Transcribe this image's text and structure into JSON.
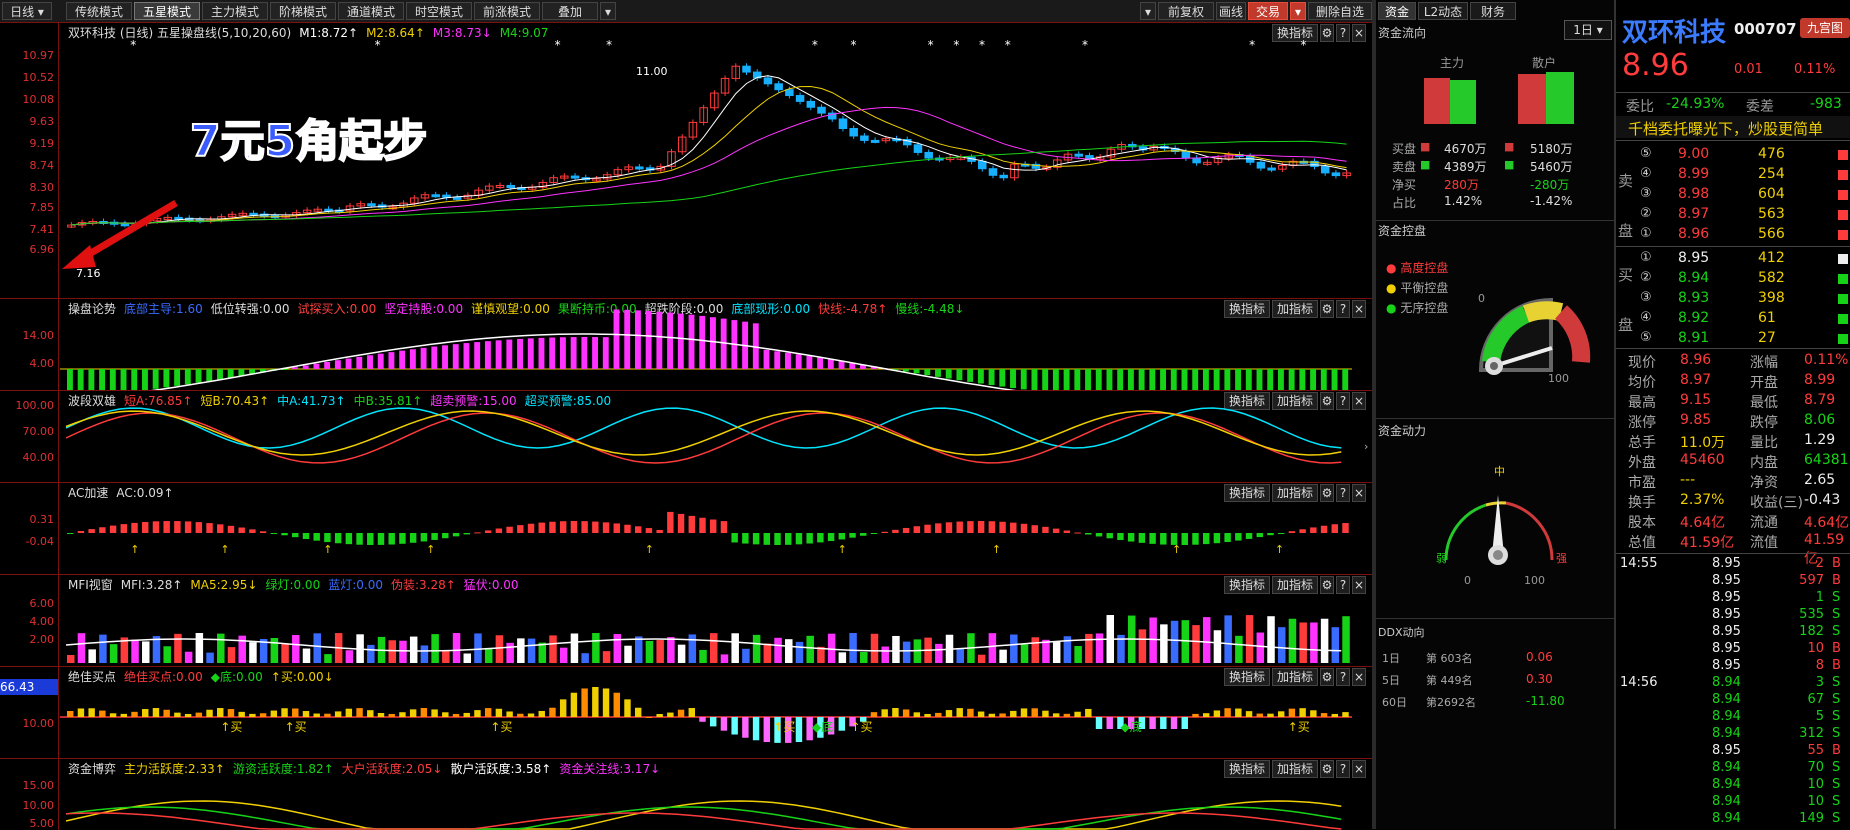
{
  "toolbar": {
    "period": "日线",
    "modes": [
      "传统模式",
      "五星模式",
      "主力模式",
      "阶梯模式",
      "通道模式",
      "时空模式",
      "前涨模式",
      "叠加"
    ],
    "adjust": "前复权",
    "draw": "画线",
    "trade": "交易",
    "del": "删除自选"
  },
  "panel_buttons": {
    "switch": "换指标",
    "add": "加指标",
    "gear": "⚙",
    "help": "?",
    "close": "×"
  },
  "main": {
    "title": [
      "双环科技 (日线) 五星操盘线(5,10,20,60)",
      "M1:8.72↑",
      "M2:8.64↑",
      "M3:8.73↓",
      "M4:9.07"
    ],
    "title_colors": [
      "#dddddd",
      "#ffffff",
      "#f0d000",
      "#ff33ff",
      "#17d317"
    ],
    "ylabels": [
      "10.97",
      "10.52",
      "10.08",
      "9.63",
      "9.19",
      "8.74",
      "8.30",
      "7.85",
      "7.41",
      "6.96"
    ],
    "annotation": "7元5角起步",
    "high_label": "11.00",
    "low_label": "7.16"
  },
  "p1": {
    "title": [
      "操盘论势",
      "底部主导:1.60",
      "低位转强:0.00",
      "试探买入:0.00",
      "坚定持股:0.00",
      "谨慎观望:0.00",
      "果断持币:0.00",
      "超跌阶段:0.00",
      "底部现形:0.00",
      "快线:-4.78↑",
      "慢线:-4.48↓"
    ],
    "title_colors": [
      "#dddddd",
      "#3a6bff",
      "#dddddd",
      "#ff4040",
      "#ff33ff",
      "#f0d000",
      "#17d317",
      "#dddddd",
      "#00e5ff",
      "#ff3b3b",
      "#17d317"
    ],
    "ylabels": [
      "14.00",
      "4.00"
    ]
  },
  "p2": {
    "title": [
      "波段双雄",
      "短A:76.85↑",
      "短B:70.43↑",
      "中A:41.73↑",
      "中B:35.81↑",
      "超卖预警:15.00",
      "超买预警:85.00"
    ],
    "title_colors": [
      "#dddddd",
      "#ff3b3b",
      "#f0d000",
      "#00e5ff",
      "#17d317",
      "#ff33ff",
      "#00e5ff"
    ],
    "ylabels": [
      "100.00",
      "70.00",
      "40.00"
    ]
  },
  "p3": {
    "title": [
      "AC加速",
      "AC:0.09↑"
    ],
    "title_colors": [
      "#dddddd",
      "#dddddd"
    ],
    "ylabels": [
      "0.31",
      "-0.04"
    ]
  },
  "p4": {
    "title": [
      "MFI视窗",
      "MFI:3.28↑",
      "MA5:2.95↓",
      "绿灯:0.00",
      "蓝灯:0.00",
      "伪装:3.28↑",
      "猛伏:0.00"
    ],
    "title_colors": [
      "#dddddd",
      "#dddddd",
      "#f0d000",
      "#17d317",
      "#3a6bff",
      "#ff3b3b",
      "#ff33ff"
    ],
    "ylabels": [
      "6.00",
      "4.00",
      "2.00"
    ]
  },
  "p5": {
    "title": [
      "绝佳买点",
      "绝佳买点:0.00",
      "◆底:0.00",
      "↑买:0.00↓"
    ],
    "title_colors": [
      "#dddddd",
      "#ff3b3b",
      "#17d317",
      "#f0d000"
    ],
    "ylabels": [
      "10.00"
    ],
    "cursor_value": "66.43",
    "buy": "买",
    "bottom": "底"
  },
  "p6": {
    "title": [
      "资金博弈",
      "主力活跃度:2.33↑",
      "游资活跃度:1.82↑",
      "大户活跃度:2.05↓",
      "散户活跃度:3.58↑",
      "资金关注线:3.17↓"
    ],
    "title_colors": [
      "#dddddd",
      "#f0d000",
      "#17d317",
      "#ff3b3b",
      "#ffffff",
      "#ff33ff"
    ],
    "ylabels": [
      "15.00",
      "10.00",
      "5.00"
    ]
  },
  "fund": {
    "tabs": [
      "资金",
      "L2动态",
      "财务"
    ],
    "period": "1日",
    "flow_title": "资金流向",
    "main_label": "主力",
    "retail_label": "散户",
    "rows": [
      {
        "label": "买盘",
        "main": "4670万",
        "retail": "5180万"
      },
      {
        "label": "卖盘",
        "main": "4389万",
        "retail": "5460万"
      },
      {
        "label": "净买",
        "main": "280万",
        "retail": "-280万"
      },
      {
        "label": "占比",
        "main": "1.42%",
        "retail": "-1.42%"
      }
    ],
    "control_title": "资金控盘",
    "control_items": [
      "高度控盘",
      "平衡控盘",
      "无序控盘"
    ],
    "gauge1_min": "0",
    "gauge1_max": "100",
    "power_title": "资金动力",
    "gauge2_labels": {
      "mid": "中",
      "weak": "弱",
      "strong": "强",
      "min": "0",
      "max": "100"
    },
    "ddx_title": "DDX动向",
    "ddx": [
      {
        "period": "1日",
        "rank": "第 603名",
        "value": "0.06"
      },
      {
        "period": "5日",
        "rank": "第 449名",
        "value": "0.30"
      },
      {
        "period": "60日",
        "rank": "第2692名",
        "value": "-11.80"
      }
    ]
  },
  "quote": {
    "name": "双环科技",
    "code": "000707",
    "tag": "九宫图",
    "price": "8.96",
    "change": "0.01",
    "pct": "0.11%",
    "weibi_label": "委比",
    "weibi": "-24.93%",
    "weicha_label": "委差",
    "weicha": "-983",
    "banner": "千档委托曝光下，炒股更简单",
    "sell_label": [
      "卖",
      "盘"
    ],
    "buy_label": [
      "买",
      "盘"
    ],
    "asks": [
      {
        "lvl": "⑤",
        "price": "9.00",
        "vol": "476"
      },
      {
        "lvl": "④",
        "price": "8.99",
        "vol": "254"
      },
      {
        "lvl": "③",
        "price": "8.98",
        "vol": "604"
      },
      {
        "lvl": "②",
        "price": "8.97",
        "vol": "563"
      },
      {
        "lvl": "①",
        "price": "8.96",
        "vol": "566"
      }
    ],
    "bids": [
      {
        "lvl": "①",
        "price": "8.95",
        "vol": "412"
      },
      {
        "lvl": "②",
        "price": "8.94",
        "vol": "582"
      },
      {
        "lvl": "③",
        "price": "8.93",
        "vol": "398"
      },
      {
        "lvl": "④",
        "price": "8.92",
        "vol": "61"
      },
      {
        "lvl": "⑤",
        "price": "8.91",
        "vol": "27"
      }
    ],
    "stats": [
      [
        "现价",
        "8.96",
        "涨幅",
        "0.11%"
      ],
      [
        "均价",
        "8.97",
        "开盘",
        "8.99"
      ],
      [
        "最高",
        "9.15",
        "最低",
        "8.79"
      ],
      [
        "涨停",
        "9.85",
        "跌停",
        "8.06"
      ],
      [
        "总手",
        "11.0万",
        "量比",
        "1.29"
      ],
      [
        "外盘",
        "45460",
        "内盘",
        "64381"
      ],
      [
        "市盈",
        "---",
        "净资",
        "2.65"
      ],
      [
        "换手",
        "2.37%",
        "收益(三)",
        "-0.43"
      ],
      [
        "股本",
        "4.64亿",
        "流通",
        "4.64亿"
      ],
      [
        "总值",
        "41.59亿",
        "流值",
        "41.59亿"
      ]
    ],
    "ticks": [
      {
        "t": "14:55",
        "p": "8.95",
        "v": "2",
        "d": "B"
      },
      {
        "t": "",
        "p": "8.95",
        "v": "597",
        "d": "B"
      },
      {
        "t": "",
        "p": "8.95",
        "v": "1",
        "d": "S"
      },
      {
        "t": "",
        "p": "8.95",
        "v": "535",
        "d": "S"
      },
      {
        "t": "",
        "p": "8.95",
        "v": "182",
        "d": "S"
      },
      {
        "t": "",
        "p": "8.95",
        "v": "10",
        "d": "B"
      },
      {
        "t": "",
        "p": "8.95",
        "v": "8",
        "d": "B"
      },
      {
        "t": "14:56",
        "p": "8.94",
        "v": "3",
        "d": "S"
      },
      {
        "t": "",
        "p": "8.94",
        "v": "67",
        "d": "S"
      },
      {
        "t": "",
        "p": "8.94",
        "v": "5",
        "d": "S"
      },
      {
        "t": "",
        "p": "8.94",
        "v": "312",
        "d": "S"
      },
      {
        "t": "",
        "p": "8.95",
        "v": "55",
        "d": "B"
      },
      {
        "t": "",
        "p": "8.94",
        "v": "70",
        "d": "S"
      },
      {
        "t": "",
        "p": "8.94",
        "v": "10",
        "d": "S"
      },
      {
        "t": "",
        "p": "8.94",
        "v": "10",
        "d": "S"
      },
      {
        "t": "",
        "p": "8.94",
        "v": "149",
        "d": "S"
      }
    ]
  },
  "colors": {
    "up": "#ff3b3b",
    "down": "#17d317",
    "accent": "#ffd24a",
    "grid": "#7a1010"
  }
}
